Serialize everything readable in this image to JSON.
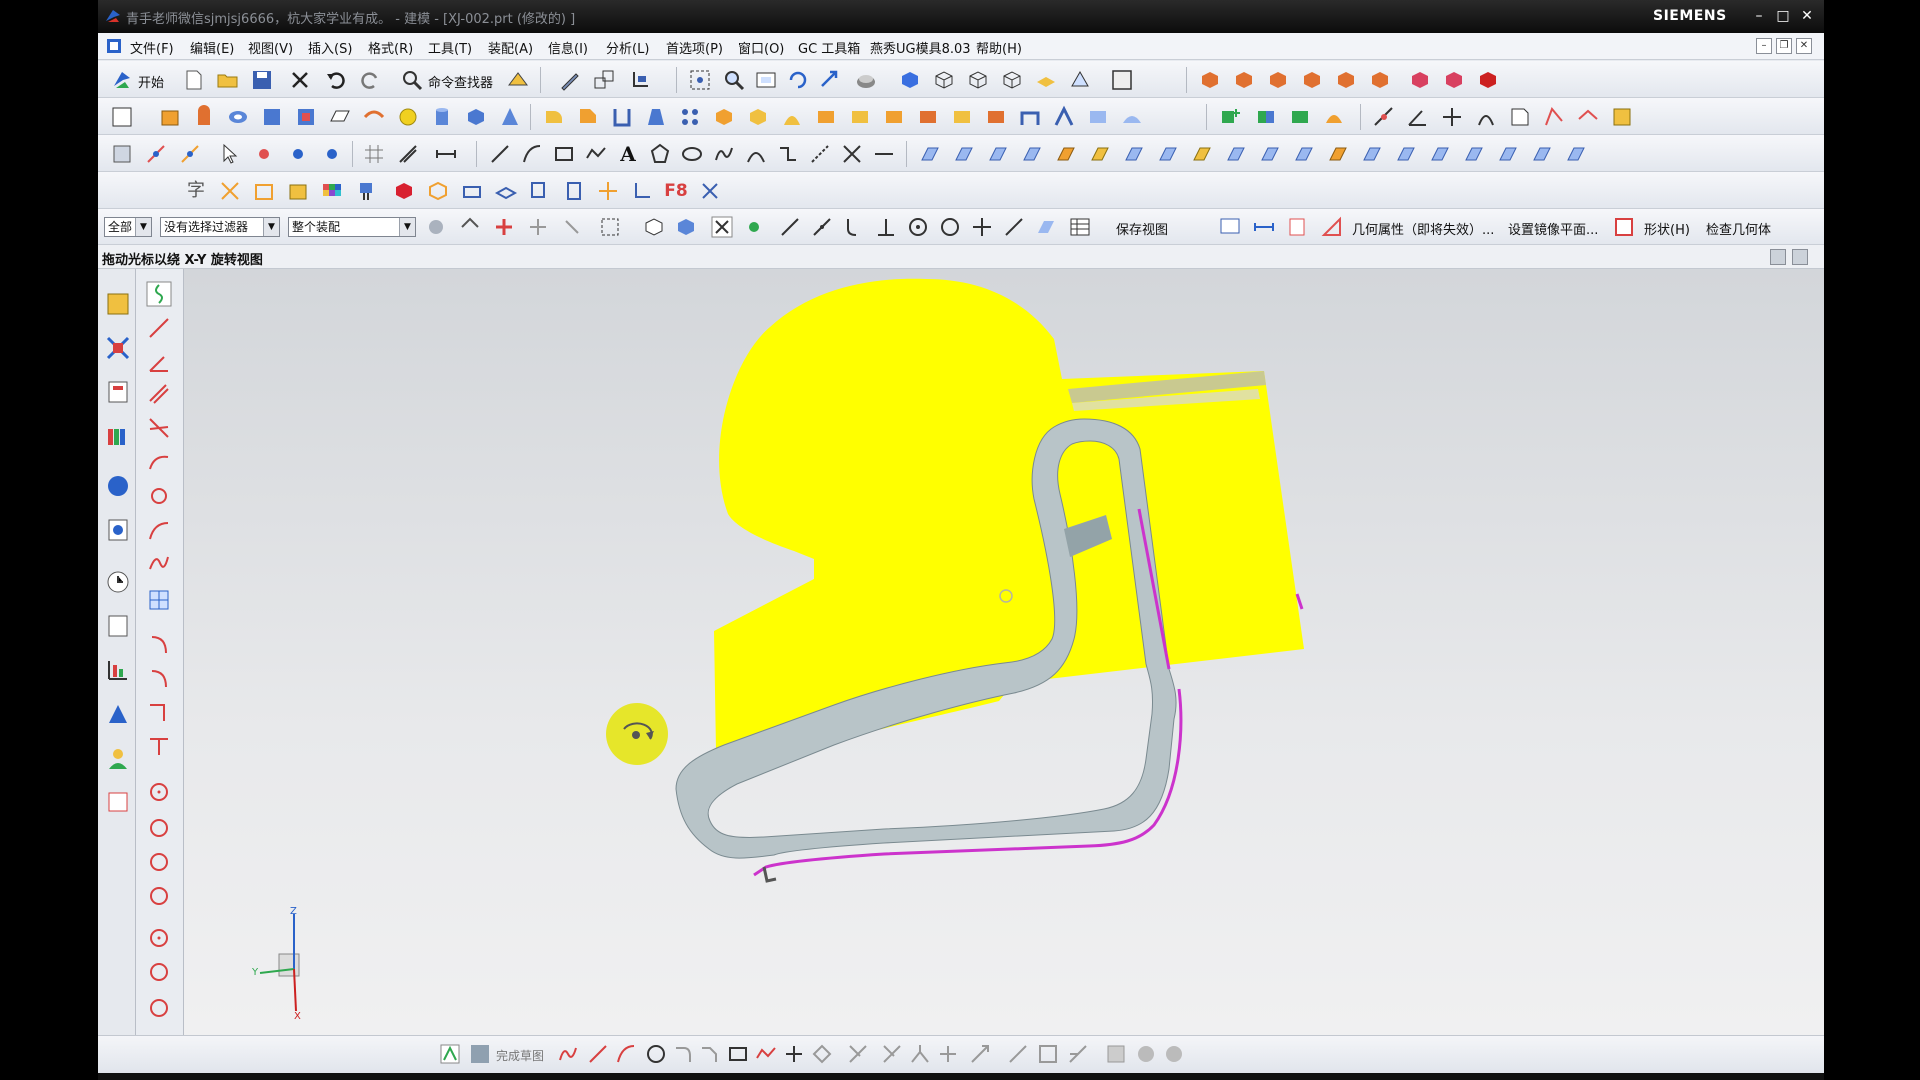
{
  "window": {
    "title": "青手老师微信sjmjsj6666，杭大家学业有成。 - 建模 - [XJ-002.prt  (修改的) ]",
    "brand": "SIEMENS",
    "min_label": "–",
    "max_label": "□",
    "close_label": "✕"
  },
  "menu": {
    "items": [
      "文件(F)",
      "编辑(E)",
      "视图(V)",
      "插入(S)",
      "格式(R)",
      "工具(T)",
      "装配(A)",
      "信息(I)",
      "分析(L)",
      "首选项(P)",
      "窗口(O)",
      "GC 工具箱",
      "燕秀UG模具8.03",
      "帮助(H)"
    ]
  },
  "toolbar1": {
    "start_label": "开始",
    "command_finder_label": "命令查找器"
  },
  "toolbar3": {
    "text_tool_label": "A"
  },
  "toolbar4": {
    "char_label": "字",
    "f8_label": "F8"
  },
  "selection_bar": {
    "filter_type": "全部",
    "selection_filter": "没有选择过滤器",
    "scope": "整个装配",
    "save_view_label": "保存视图",
    "geometry_props_label": "几何属性（即将失效）...",
    "mirror_plane_label": "设置镜像平面...",
    "shape_label": "形状(H)",
    "check_geometry_label": "检查几何体"
  },
  "cue_line": {
    "text": "拖动光标以绕 X-Y 旋转视图"
  },
  "bottom_bar": {
    "finish_sketch_label": "完成草图"
  },
  "triad": {
    "z": "Z",
    "y": "Y",
    "x": "X"
  },
  "colors": {
    "part_face": "#ffff00",
    "frame_body": "#b8c4c8",
    "frame_edge": "#cc33cc",
    "cursor_disc": "#e6e62a",
    "accent_blue": "#2a62c9"
  }
}
